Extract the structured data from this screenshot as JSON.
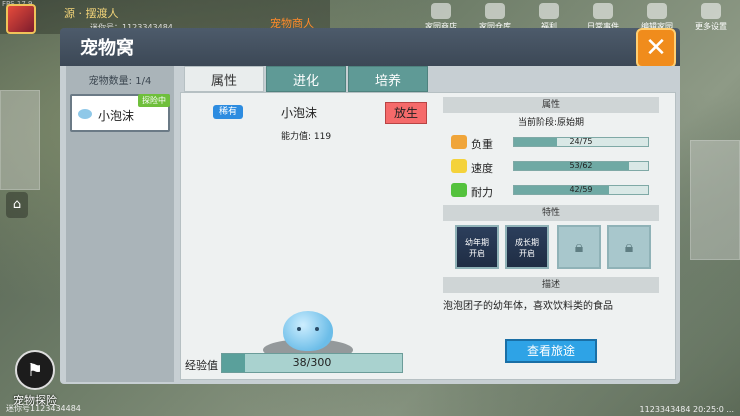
{
  "hud": {
    "fps": "FPS 17.9",
    "player_name": "源 · 摆渡人",
    "player_id": "迷你号：1123343484",
    "room_title": "宠物商人",
    "top_icons": [
      "家园商店",
      "家园仓库",
      "福利",
      "日常事件",
      "编辑家园",
      "更多设置"
    ],
    "home_icon": "home-icon",
    "pet_explore_label": "宠物探险",
    "bottom_left": "迷你号1123434484",
    "bottom_right": "1123343484 20:25:0 ..."
  },
  "dialog": {
    "title": "宠物窝",
    "close_icon": "close-x-icon",
    "pet_count": "宠物数量: 1/4",
    "pets": [
      {
        "name": "小泡沫",
        "tag": "探险中"
      }
    ],
    "tabs": [
      "属性",
      "进化",
      "培养"
    ],
    "active_tab": 0,
    "pet_detail": {
      "rarity": "稀有",
      "name": "小泡沫",
      "release_label": "放生",
      "ability_label": "能力值: 119",
      "exp_label": "经验值",
      "exp_text": "38/300",
      "exp_fraction": 0.1267
    },
    "attributes": {
      "header": "属性",
      "stage": "当前阶段:原始期",
      "stats": [
        {
          "name": "负重",
          "icon": "backpack-icon",
          "text": "24/75",
          "fraction": 0.32,
          "color": "#f0a53a"
        },
        {
          "name": "速度",
          "icon": "wing-icon",
          "text": "53/62",
          "fraction": 0.855,
          "color": "#f4d23a"
        },
        {
          "name": "耐力",
          "icon": "muscle-icon",
          "text": "42/59",
          "fraction": 0.712,
          "color": "#54c23d"
        }
      ]
    },
    "traits": {
      "header": "特性",
      "slots": [
        {
          "label": "幼年期\n开启",
          "state": "on"
        },
        {
          "label": "成长期\n开启",
          "state": "on"
        },
        {
          "label": "",
          "state": "locked",
          "icon": "lock-icon"
        },
        {
          "label": "",
          "state": "locked",
          "icon": "lock-icon"
        }
      ]
    },
    "description": {
      "header": "描述",
      "text": "泡泡团子的幼年体，喜欢饮料类的食品"
    },
    "journey_button": "查看旅途"
  }
}
